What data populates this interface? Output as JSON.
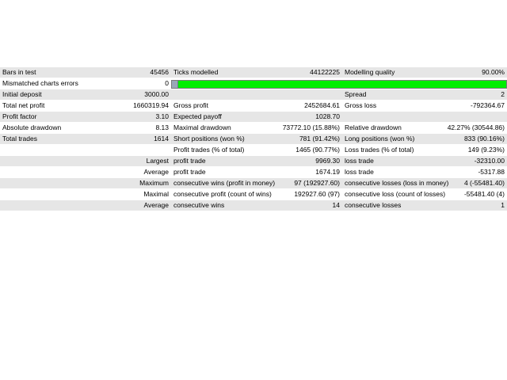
{
  "quality": {
    "fill_color": "#00ee00",
    "gap_color": "#9aa6b8",
    "fraction_green": 0.98
  },
  "rows": {
    "r1": {
      "a_label": "Bars in test",
      "a_value": "45456",
      "b_label": "Ticks modelled",
      "b_value": "44122225",
      "c_label": "Modelling quality",
      "c_value": "90.00%"
    },
    "r2": {
      "a_label": "Mismatched charts errors",
      "a_value": "0"
    },
    "r3": {
      "a_label": "Initial deposit",
      "a_value": "3000.00",
      "c_label": "Spread",
      "c_value": "2"
    },
    "r4": {
      "a_label": "Total net profit",
      "a_value": "1660319.94",
      "b_label": "Gross profit",
      "b_value": "2452684.61",
      "c_label": "Gross loss",
      "c_value": "-792364.67"
    },
    "r5": {
      "a_label": "Profit factor",
      "a_value": "3.10",
      "b_label": "Expected payoff",
      "b_value": "1028.70"
    },
    "r6": {
      "a_label": "Absolute drawdown",
      "a_value": "8.13",
      "b_label": "Maximal drawdown",
      "b_value": "73772.10 (15.88%)",
      "c_label": "Relative drawdown",
      "c_value": "42.27% (30544.86)"
    },
    "r7": {
      "a_label": "Total trades",
      "a_value": "1614",
      "b_label": "Short positions (won %)",
      "b_value": "781 (91.42%)",
      "c_label": "Long positions (won %)",
      "c_value": "833 (90.16%)"
    },
    "r8": {
      "b_label": "Profit trades (% of total)",
      "b_value": "1465 (90.77%)",
      "c_label": "Loss trades (% of total)",
      "c_value": "149 (9.23%)"
    },
    "r9": {
      "a_value": "Largest",
      "b_label": "profit trade",
      "b_value": "9969.30",
      "c_label": "loss trade",
      "c_value": "-32310.00"
    },
    "r10": {
      "a_value": "Average",
      "b_label": "profit trade",
      "b_value": "1674.19",
      "c_label": "loss trade",
      "c_value": "-5317.88"
    },
    "r11": {
      "a_value": "Maximum",
      "b_label": "consecutive wins (profit in money)",
      "b_value": "97 (192927.60)",
      "c_label": "consecutive losses (loss in money)",
      "c_value": "4 (-55481.40)"
    },
    "r12": {
      "a_value": "Maximal",
      "b_label": "consecutive profit (count of wins)",
      "b_value": "192927.60 (97)",
      "c_label": "consecutive loss (count of losses)",
      "c_value": "-55481.40 (4)"
    },
    "r13": {
      "a_value": "Average",
      "b_label": "consecutive wins",
      "b_value": "14",
      "c_label": "consecutive losses",
      "c_value": "1"
    }
  }
}
